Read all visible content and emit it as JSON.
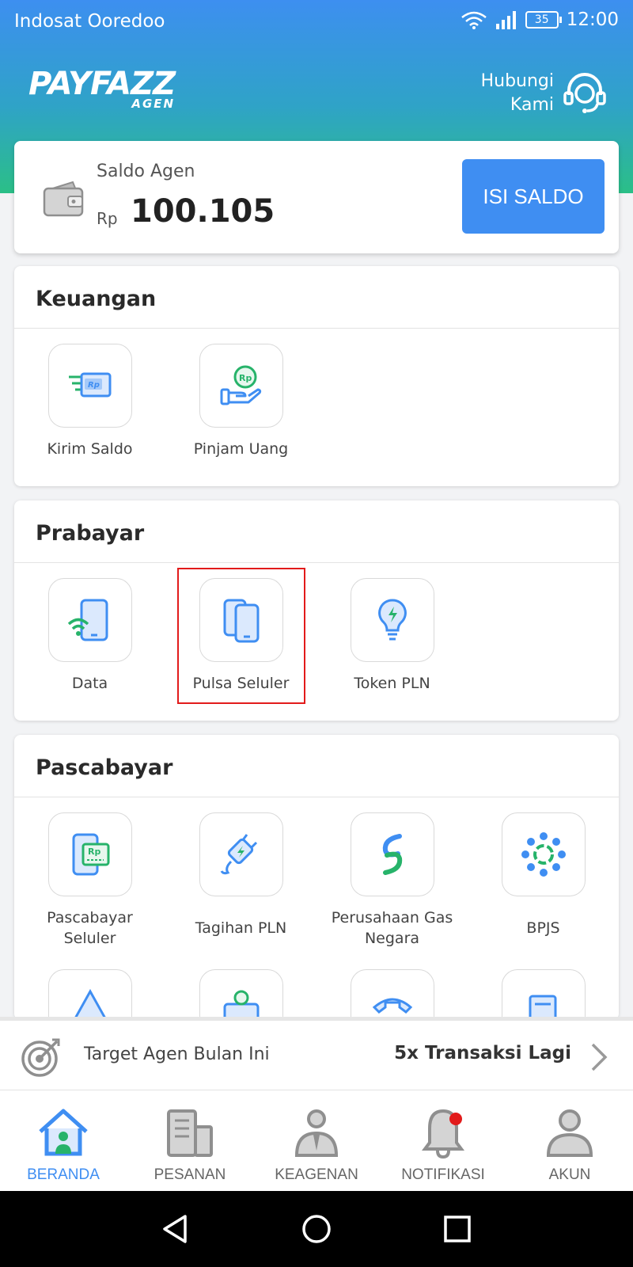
{
  "status_bar": {
    "carrier": "Indosat Ooredoo",
    "battery": "35",
    "time": "12:00"
  },
  "header": {
    "logo": "PAYFAZZ",
    "logo_sub": "AGEN",
    "contact_line1": "Hubungi",
    "contact_line2": "Kami"
  },
  "balance": {
    "label": "Saldo Agen",
    "currency": "Rp",
    "amount": "100.105",
    "topup_button": "ISI SALDO"
  },
  "sections": {
    "keuangan": {
      "title": "Keuangan",
      "items": [
        {
          "label": "Kirim Saldo",
          "icon": "send-money-icon"
        },
        {
          "label": "Pinjam Uang",
          "icon": "loan-icon"
        }
      ]
    },
    "prabayar": {
      "title": "Prabayar",
      "items": [
        {
          "label": "Data",
          "icon": "mobile-data-icon"
        },
        {
          "label": "Pulsa Seluler",
          "icon": "phone-credit-icon"
        },
        {
          "label": "Token PLN",
          "icon": "lightbulb-icon"
        }
      ]
    },
    "pascabayar": {
      "title": "Pascabayar",
      "items": [
        {
          "label_line1": "Pascabayar",
          "label_line2": "Seluler",
          "icon": "postpaid-phone-icon"
        },
        {
          "label": "Tagihan PLN",
          "icon": "power-plug-icon"
        },
        {
          "label_line1": "Perusahaan Gas",
          "label_line2": "Negara",
          "icon": "gas-icon"
        },
        {
          "label": "BPJS",
          "icon": "bpjs-icon"
        }
      ]
    }
  },
  "target": {
    "label": "Target Agen Bulan Ini",
    "value": "5x Transaksi Lagi"
  },
  "bottom_nav": {
    "items": [
      {
        "label": "BERANDA",
        "icon": "home-icon",
        "active": true
      },
      {
        "label": "PESANAN",
        "icon": "orders-icon",
        "active": false
      },
      {
        "label": "KEAGENAN",
        "icon": "agent-icon",
        "active": false
      },
      {
        "label": "NOTIFIKASI",
        "icon": "bell-icon",
        "active": false
      },
      {
        "label": "AKUN",
        "icon": "account-icon",
        "active": false
      }
    ]
  },
  "colors": {
    "primary": "#3f8ef2",
    "header_top": "#3d8ff0",
    "header_bottom": "#2bbf87",
    "icon_green": "#27b36a",
    "highlight": "#e21b1b"
  }
}
